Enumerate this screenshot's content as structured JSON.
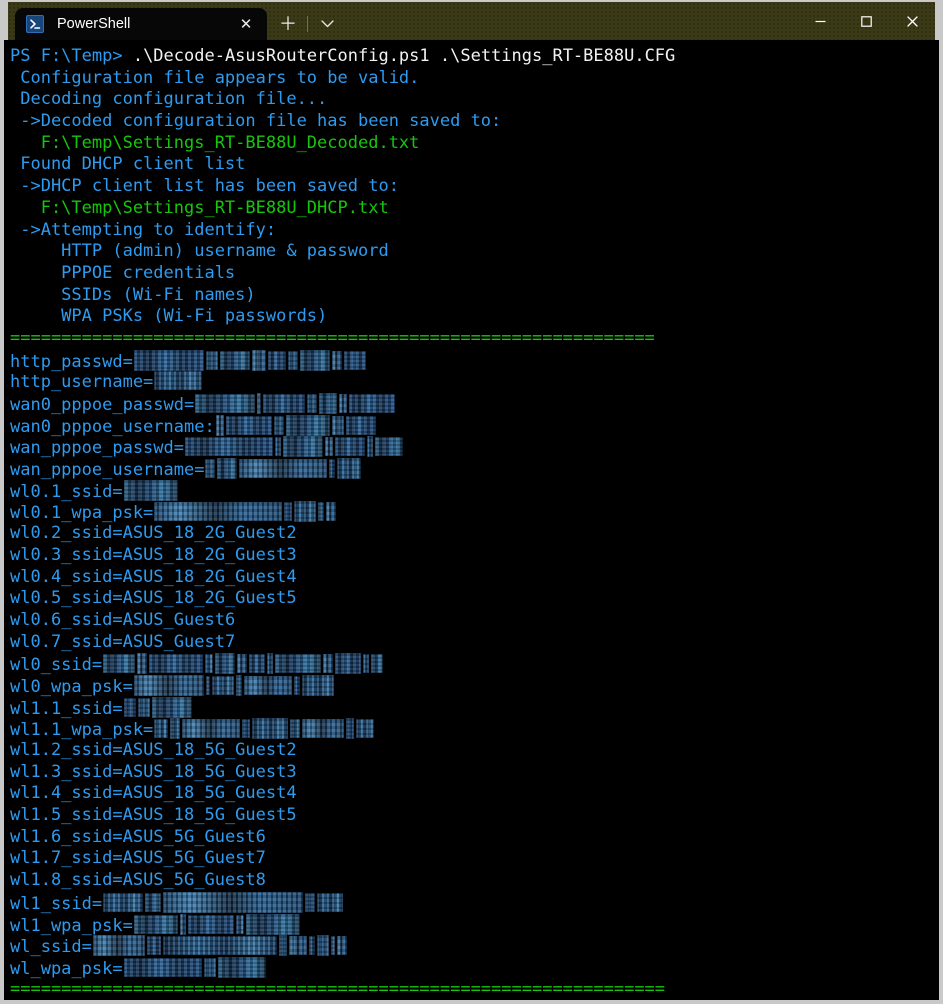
{
  "window": {
    "titlebar_color": "#3b3a16",
    "border_color": "#c9c9c9",
    "terminal_bg": "#000000"
  },
  "tab": {
    "title": "PowerShell",
    "icon": "powershell-icon",
    "close_glyph": "✕"
  },
  "toolbar": {
    "new_tab_glyph": "＋",
    "dropdown_glyph": "⌵"
  },
  "caption": {
    "minimize_glyph": "─",
    "maximize_glyph": "□",
    "close_glyph": "✕"
  },
  "terminal": {
    "colors": {
      "prompt": "#2e9bf0",
      "command": "#f2f2f2",
      "info": "#2e9bf0",
      "path": "#16c60c",
      "separator": "#16c60c",
      "redaction": "#16395e"
    },
    "prompt": "PS F:\\Temp> ",
    "command": ".\\Decode-AsusRouterConfig.ps1 .\\Settings_RT-BE88U.CFG",
    "output": [
      " Configuration file appears to be valid.",
      " Decoding configuration file...",
      " ->Decoded configuration file has been saved to:",
      "   F:\\Temp\\Settings_RT-BE88U_Decoded.txt",
      " Found DHCP client list",
      " ->DHCP client list has been saved to:",
      "   F:\\Temp\\Settings_RT-BE88U_DHCP.txt",
      " ->Attempting to identify:",
      "     HTTP (admin) username & password",
      "     PPPOE credentials",
      "     SSIDs (Wi-Fi names)",
      "     WPA PSKs (Wi-Fi passwords)"
    ],
    "green_path_lines": [
      3,
      6
    ],
    "separator": "===============================================================",
    "config_lines": [
      {
        "key": "http_passwd=",
        "redacted": true,
        "value": "",
        "blocks": [
          70,
          12,
          30,
          14,
          18,
          10,
          30,
          10,
          22
        ]
      },
      {
        "key": "http_username=",
        "redacted": true,
        "value": "",
        "blocks": [
          48
        ]
      },
      {
        "key": "wan0_pppoe_passwd=",
        "redacted": true,
        "value": "",
        "blocks": [
          60,
          4,
          42,
          10,
          18,
          8,
          46
        ]
      },
      {
        "key": "wan0_pppoe_username:",
        "redacted": true,
        "value": "",
        "blocks": [
          8,
          46,
          10,
          44,
          12,
          30
        ]
      },
      {
        "key": "wan_pppoe_passwd=",
        "redacted": true,
        "value": "",
        "blocks": [
          88,
          6,
          40,
          8,
          30,
          6,
          28
        ]
      },
      {
        "key": "wan_pppoe_username=",
        "redacted": true,
        "value": "",
        "blocks": [
          10,
          20,
          88,
          6,
          24
        ]
      },
      {
        "key": "wl0.1_ssid=",
        "redacted": true,
        "value": "",
        "blocks": [
          54
        ]
      },
      {
        "key": "wl0.1_wpa_psk=",
        "redacted": true,
        "value": "",
        "blocks": [
          128,
          8,
          22,
          6,
          10
        ]
      },
      {
        "key": "wl0.2_ssid=",
        "redacted": false,
        "value": "ASUS_18_2G_Guest2"
      },
      {
        "key": "wl0.3_ssid=",
        "redacted": false,
        "value": "ASUS_18_2G_Guest3"
      },
      {
        "key": "wl0.4_ssid=",
        "redacted": false,
        "value": "ASUS_18_2G_Guest4"
      },
      {
        "key": "wl0.5_ssid=",
        "redacted": false,
        "value": "ASUS_18_2G_Guest5"
      },
      {
        "key": "wl0.6_ssid=",
        "redacted": false,
        "value": "ASUS_Guest6"
      },
      {
        "key": "wl0.7_ssid=",
        "redacted": false,
        "value": "ASUS_Guest7"
      },
      {
        "key": "wl0_ssid=",
        "redacted": true,
        "value": "",
        "blocks": [
          32,
          10,
          54,
          8,
          20,
          10,
          16,
          6,
          46,
          10,
          26,
          6,
          12
        ]
      },
      {
        "key": "wl0_wpa_psk=",
        "redacted": true,
        "value": "",
        "blocks": [
          70,
          4,
          22,
          6,
          48,
          6,
          32
        ]
      },
      {
        "key": "wl1.1_ssid=",
        "redacted": true,
        "value": "",
        "blocks": [
          12,
          12,
          40
        ]
      },
      {
        "key": "wl1.1_wpa_psk=",
        "redacted": true,
        "value": "",
        "blocks": [
          14,
          10,
          58,
          8,
          36,
          10,
          42,
          8,
          18
        ]
      },
      {
        "key": "wl1.2_ssid=",
        "redacted": false,
        "value": "ASUS_18_5G_Guest2"
      },
      {
        "key": "wl1.3_ssid=",
        "redacted": false,
        "value": "ASUS_18_5G_Guest3"
      },
      {
        "key": "wl1.4_ssid=",
        "redacted": false,
        "value": "ASUS_18_5G_Guest4"
      },
      {
        "key": "wl1.5_ssid=",
        "redacted": false,
        "value": "ASUS_18_5G_Guest5"
      },
      {
        "key": "wl1.6_ssid=",
        "redacted": false,
        "value": "ASUS_5G_Guest6"
      },
      {
        "key": "wl1.7_ssid=",
        "redacted": false,
        "value": "ASUS_5G_Guest7"
      },
      {
        "key": "wl1.8_ssid=",
        "redacted": false,
        "value": "ASUS_5G_Guest8"
      },
      {
        "key": "wl1_ssid=",
        "redacted": true,
        "value": "",
        "blocks": [
          40,
          16,
          140,
          10,
          26
        ]
      },
      {
        "key": "wl1_wpa_psk=",
        "redacted": true,
        "value": "",
        "blocks": [
          44,
          6,
          46,
          8,
          54
        ]
      },
      {
        "key": "wl_ssid=",
        "redacted": true,
        "value": "",
        "blocks": [
          52,
          14,
          114,
          8,
          18,
          6,
          12,
          4,
          10
        ]
      },
      {
        "key": "wl_wpa_psk=",
        "redacted": true,
        "value": "",
        "blocks": [
          78,
          12,
          48
        ]
      }
    ],
    "separator_bottom": "================================================================"
  }
}
